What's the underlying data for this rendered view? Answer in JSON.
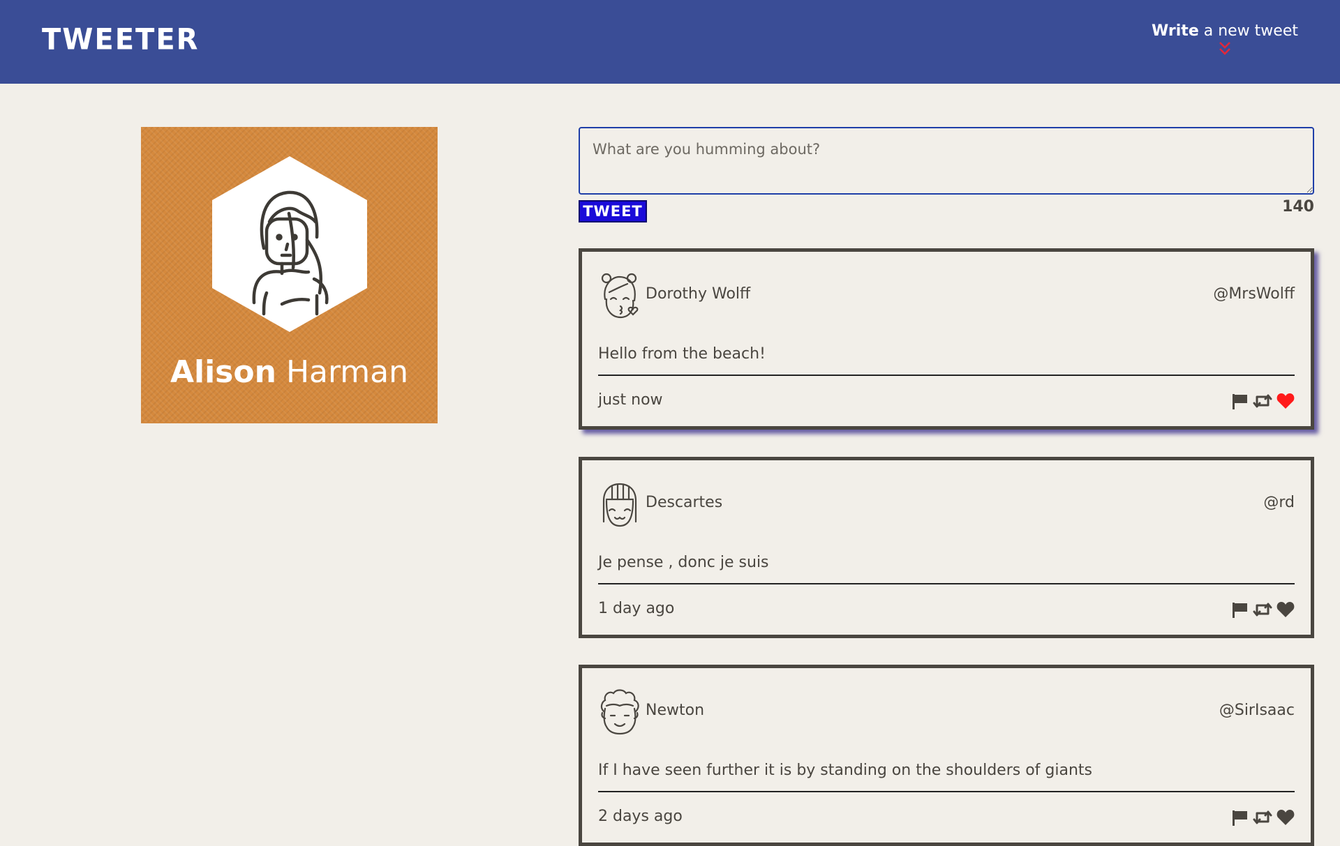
{
  "nav": {
    "brand": "TWEETER",
    "compose_bold": "Write",
    "compose_rest": " a new tweet"
  },
  "profile": {
    "first_name": "Alison",
    "last_name": "Harman",
    "background_color": "#d5893d"
  },
  "composer": {
    "placeholder": "What are you humming about?",
    "button_label": "TWEET",
    "counter": "140"
  },
  "tweets": [
    {
      "name": "Dorothy Wolff",
      "handle": "@MrsWolff",
      "text": "Hello from the beach!",
      "time": "just now",
      "liked": true,
      "avatar_icon": "kissing-girl-avatar-icon"
    },
    {
      "name": "Descartes",
      "handle": "@rd",
      "text": "Je pense , donc je suis",
      "time": "1 day ago",
      "liked": false,
      "avatar_icon": "bob-hair-avatar-icon"
    },
    {
      "name": "Newton",
      "handle": "@SirIsaac",
      "text": "If I have seen further it is by standing on the shoulders of giants",
      "time": "2 days ago",
      "liked": false,
      "avatar_icon": "curly-hair-avatar-icon"
    }
  ],
  "icons": {
    "flag": "flag-icon",
    "retweet": "retweet-icon",
    "like": "heart-icon",
    "compose": "double-chevron-down-icon"
  },
  "colors": {
    "nav": "#3a4d96",
    "page": "#f2efe9",
    "tweet_button": "#1a0bd9",
    "liked_heart": "#ff1a1a",
    "compose_chevron": "#e0283a"
  }
}
